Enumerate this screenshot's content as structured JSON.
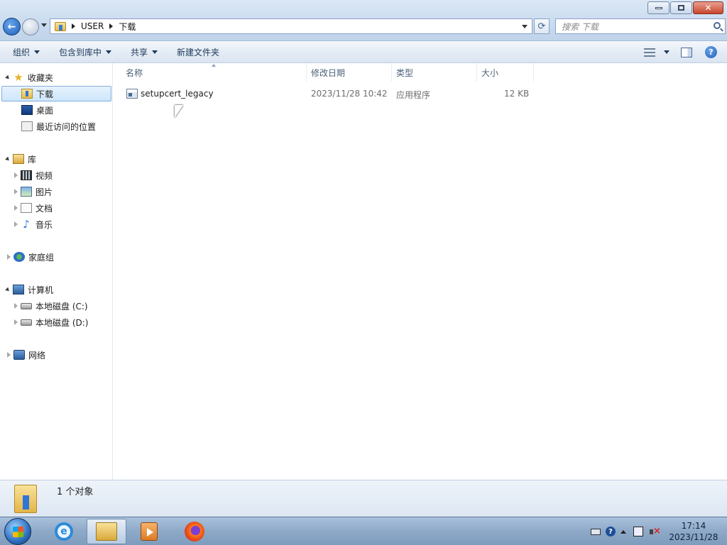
{
  "window": {
    "controls": {
      "minimize_icon": "minimize-icon",
      "restore_icon": "restore-icon",
      "close_icon": "close-icon"
    }
  },
  "address": {
    "crumbs": [
      "USER",
      "下载"
    ],
    "search_placeholder": "搜索 下载"
  },
  "toolbar": {
    "organize": "组织",
    "include_in_library": "包含到库中",
    "share": "共享",
    "new_folder": "新建文件夹"
  },
  "nav": {
    "favorites": {
      "label": "收藏夹",
      "items": [
        "下载",
        "桌面",
        "最近访问的位置"
      ]
    },
    "libraries": {
      "label": "库",
      "items": [
        "视频",
        "图片",
        "文档",
        "音乐"
      ]
    },
    "homegroup": "家庭组",
    "computer": {
      "label": "计算机",
      "items": [
        "本地磁盘 (C:)",
        "本地磁盘 (D:)"
      ]
    },
    "network": "网络"
  },
  "columns": [
    "名称",
    "修改日期",
    "类型",
    "大小"
  ],
  "files": [
    {
      "name": "setupcert_legacy",
      "modified": "2023/11/28 10:42",
      "type": "应用程序",
      "size": "12 KB"
    }
  ],
  "details": {
    "count": "1 个对象"
  },
  "taskbar": {
    "time": "17:14",
    "date": "2023/11/28"
  }
}
